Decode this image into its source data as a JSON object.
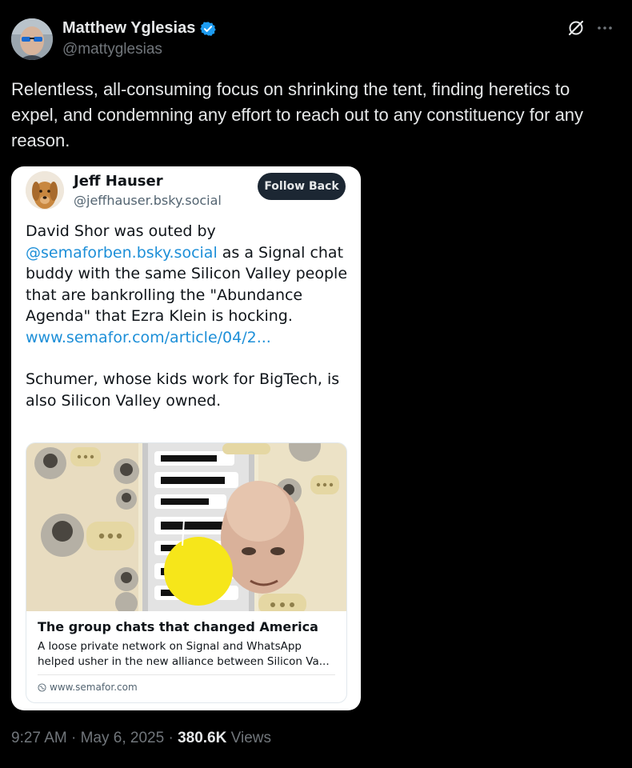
{
  "author": {
    "name": "Matthew Yglesias",
    "handle": "@mattyglesias",
    "verified": true
  },
  "tweet": {
    "text": "Relentless, all-consuming focus on shrinking the tent, finding heretics to expel, and condemning any effort to reach out to any constituency for any reason.",
    "time": "9:27 AM",
    "date": "May 6, 2025",
    "separator": "·",
    "views_count": "380.6K",
    "views_label": "Views"
  },
  "embed": {
    "author_name": "Jeff Hauser",
    "author_handle": "@jeffhauser.bsky.social",
    "follow_label": "Follow Back",
    "text_part1": "David Shor was outed by ",
    "mention": "@semaforben.bsky.social",
    "text_part2": " as a Signal chat buddy with the same Silicon Valley people that are bankrolling the \"Abundance Agenda\" that Ezra Klein is hocking. ",
    "link": "www.semafor.com/article/04/2...",
    "text_part3": "Schumer, whose kids work for BigTech, is also Silicon Valley owned.",
    "card": {
      "title": "The group chats that changed America",
      "description": "A loose private network on Signal and WhatsApp helped usher in the new alliance between Silicon Va...",
      "domain": "www.semafor.com"
    }
  },
  "icons": {
    "verified": "verified-badge-icon",
    "grok": "grok-icon",
    "more": "more-options-icon",
    "globe": "globe-icon"
  },
  "colors": {
    "background": "#000000",
    "text": "#e7e9ea",
    "secondary": "#71767b",
    "verified_blue": "#1d9bf0",
    "link_blue": "#1d8fd8",
    "follow_button": "#1c2733",
    "highlight_yellow": "#f6e61a"
  }
}
